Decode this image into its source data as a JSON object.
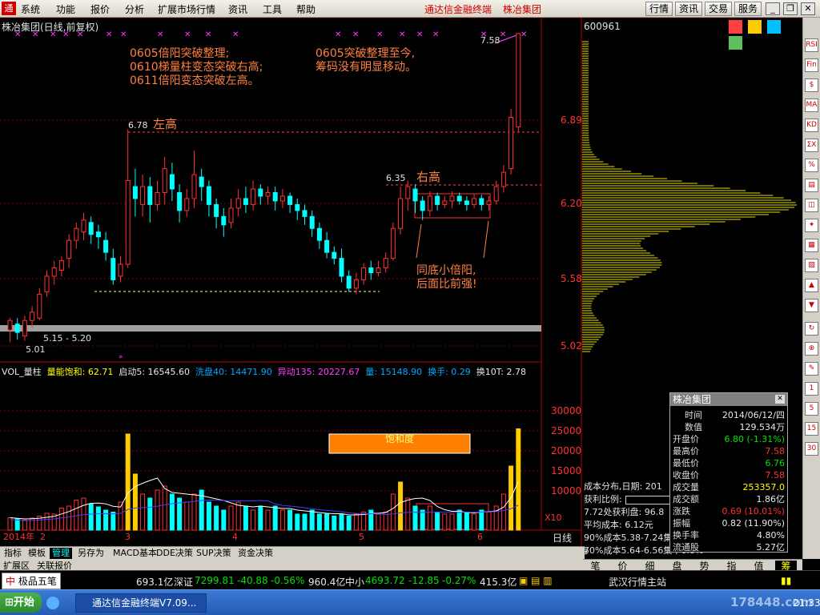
{
  "menu": {
    "items": [
      "系统",
      "功能",
      "报价",
      "分析",
      "扩展市场行情",
      "资讯",
      "工具",
      "帮助"
    ],
    "app_title": "通达信金融终端",
    "stock_title": "株冶集团",
    "buttons": [
      "行情",
      "资讯",
      "交易",
      "服务"
    ]
  },
  "chart": {
    "header": "株冶集团(日线,前复权)",
    "code": "600961",
    "price_labels": [
      "6.89",
      "6.20",
      "5.58",
      "5.02"
    ],
    "vol_labels": [
      "30000",
      "25000",
      "20000",
      "15000",
      "10000"
    ],
    "annotation1": [
      "0605倍阳突破整理;",
      "0610梯量柱变态突破右高;",
      "0611倍阳变态突破左高。"
    ],
    "annotation2": [
      "0605突破整理至今,",
      "筹码没有明显移动。"
    ],
    "left_high_label": "左高",
    "left_high_value": "6.78",
    "right_high_label": "右高",
    "right_high_value": "6.35",
    "peak_value": "7.58",
    "low_value": "5.01",
    "band_label": "5.15 - 5.20",
    "note": [
      "同底小倍阳,",
      "后面比前强!"
    ],
    "saturation_label": "饱和度",
    "x_labels": [
      "2014年",
      "2",
      "3",
      "4",
      "5",
      "6"
    ],
    "period": "日线",
    "x10": "X10",
    "vol_header": [
      {
        "t": "VOL_量柱",
        "c": "w"
      },
      {
        "t": "量能饱和: 62.71",
        "c": "y"
      },
      {
        "t": "启动5: 16545.60",
        "c": "w"
      },
      {
        "t": "洗盘40: 14471.90",
        "c": "c"
      },
      {
        "t": "异动135: 20227.67",
        "c": "m"
      },
      {
        "t": "量: 15148.90",
        "c": "c"
      },
      {
        "t": "换手: 0.29",
        "c": "c"
      },
      {
        "t": "换10T: 2.78",
        "c": "w"
      }
    ]
  },
  "cost": {
    "title": "成本分布,日期: 201",
    "ratio_label": "获利比例:",
    "row1": "7.72处获利盘: 96.8",
    "row2": "平均成本: 6.12元",
    "row3": "90%成本5.38-7.24集",
    "row4": "70%成本5.64-6.56集中6.8%"
  },
  "infobox": {
    "title": "株冶集团",
    "rows": [
      {
        "l": "时间",
        "v": "2014/06/12/四",
        "c": "w"
      },
      {
        "l": "数值",
        "v": "129.534万",
        "c": "w"
      },
      {
        "l": "开盘价",
        "v": "6.80 (-1.31%)",
        "c": "g"
      },
      {
        "l": "最高价",
        "v": "7.58",
        "c": "r"
      },
      {
        "l": "最低价",
        "v": "6.76",
        "c": "g"
      },
      {
        "l": "收盘价",
        "v": "7.58",
        "c": "r"
      },
      {
        "l": "成交量",
        "v": "253357.0",
        "c": "y"
      },
      {
        "l": "成交额",
        "v": "1.86亿",
        "c": "w"
      },
      {
        "l": "涨跌",
        "v": "0.69 (10.01%)",
        "c": "r"
      },
      {
        "l": "振幅",
        "v": "0.82 (11.90%)",
        "c": "w"
      },
      {
        "l": "换手率",
        "v": "4.80%",
        "c": "w"
      },
      {
        "l": "流通股",
        "v": "5.27亿",
        "c": "w"
      }
    ]
  },
  "bottom_tabs": [
    "指标",
    "模板",
    "管理",
    "另存为",
    "MACD基本",
    "DDE决策",
    "SUP决策",
    "资金决策"
  ],
  "ext_tabs": [
    "扩展区",
    "关联报价"
  ],
  "profile_tabs": [
    "笔",
    "价",
    "细",
    "盘",
    "势",
    "指",
    "值",
    "筹"
  ],
  "ticker": {
    "brand": "极品五笔",
    "t1": "693.1亿",
    "t2_name": "深证",
    "t2_val": "7299.81",
    "t2_chg": "-40.88",
    "t2_pct": "-0.56%",
    "t2_amt": "960.4亿",
    "t3_name": "中小",
    "t3_val": "4693.72",
    "t3_chg": "-12.85",
    "t3_pct": "-0.27%",
    "t3_amt": "415.3亿",
    "station": "武汉行情主站"
  },
  "taskbar": {
    "start": "开始",
    "window": "通达信金融终端V7.09...",
    "clock": "21:33",
    "watermark": "178448.com"
  },
  "right_tools": [
    "RSI",
    "Fin",
    "$",
    "MA",
    "KD",
    "ΣX",
    "%"
  ],
  "chart_data": {
    "type": "candlestick",
    "price_range": [
      4.9,
      7.62
    ],
    "volume_range": [
      0,
      32000
    ],
    "lines": {
      "left_high": 6.78,
      "right_high": 6.35,
      "support": 5.5,
      "band_low": 5.15
    },
    "candles": [
      [
        5.1,
        5.18,
        5.0,
        5.2
      ],
      [
        5.15,
        5.08,
        5.02,
        5.2
      ],
      [
        5.05,
        5.18,
        5.01,
        5.22
      ],
      [
        5.18,
        5.25,
        5.12,
        5.3
      ],
      [
        5.2,
        5.4,
        5.18,
        5.45
      ],
      [
        5.42,
        5.55,
        5.38,
        5.6
      ],
      [
        5.55,
        5.62,
        5.48,
        5.68
      ],
      [
        5.6,
        5.68,
        5.55,
        5.72
      ],
      [
        5.7,
        5.85,
        5.62,
        5.9
      ],
      [
        5.85,
        5.95,
        5.78,
        6.0
      ],
      [
        5.92,
        6.02,
        5.85,
        6.08
      ],
      [
        6.0,
        5.9,
        5.82,
        6.05
      ],
      [
        5.92,
        5.88,
        5.78,
        5.98
      ],
      [
        5.85,
        5.75,
        5.68,
        5.92
      ],
      [
        5.7,
        5.52,
        5.48,
        5.78
      ],
      [
        5.55,
        5.65,
        5.5,
        5.72
      ],
      [
        5.65,
        6.35,
        5.62,
        6.78
      ],
      [
        6.3,
        6.2,
        6.05,
        6.45
      ],
      [
        6.15,
        6.3,
        6.05,
        6.4
      ],
      [
        6.3,
        6.15,
        6.0,
        6.38
      ],
      [
        6.15,
        6.25,
        6.1,
        6.35
      ],
      [
        6.25,
        6.45,
        6.15,
        6.55
      ],
      [
        6.4,
        6.28,
        6.18,
        6.5
      ],
      [
        6.25,
        6.1,
        6.0,
        6.32
      ],
      [
        6.1,
        6.2,
        6.05,
        6.28
      ],
      [
        6.2,
        6.4,
        6.12,
        6.6
      ],
      [
        6.38,
        6.3,
        6.18,
        6.45
      ],
      [
        6.3,
        6.15,
        6.05,
        6.35
      ],
      [
        6.15,
        6.05,
        5.95,
        6.2
      ],
      [
        6.05,
        5.98,
        5.88,
        6.12
      ],
      [
        6.0,
        6.12,
        5.95,
        6.2
      ],
      [
        6.12,
        6.2,
        6.05,
        6.28
      ],
      [
        6.2,
        6.15,
        6.08,
        6.3
      ],
      [
        6.15,
        6.28,
        6.1,
        6.35
      ],
      [
        6.28,
        6.22,
        6.15,
        6.32
      ],
      [
        6.22,
        6.25,
        6.15,
        6.3
      ],
      [
        6.25,
        6.18,
        6.1,
        6.3
      ],
      [
        6.18,
        6.22,
        6.12,
        6.28
      ],
      [
        6.22,
        6.15,
        6.08,
        6.25
      ],
      [
        6.15,
        6.1,
        6.02,
        6.2
      ],
      [
        6.1,
        6.05,
        5.98,
        6.15
      ],
      [
        6.05,
        5.95,
        5.88,
        6.1
      ],
      [
        5.95,
        5.85,
        5.78,
        6.0
      ],
      [
        5.85,
        5.75,
        5.7,
        5.92
      ],
      [
        5.75,
        5.7,
        5.65,
        5.8
      ],
      [
        5.7,
        5.55,
        5.5,
        5.78
      ],
      [
        5.55,
        5.45,
        5.42,
        5.6
      ],
      [
        5.45,
        5.52,
        5.4,
        5.58
      ],
      [
        5.52,
        5.62,
        5.48,
        5.66
      ],
      [
        5.62,
        5.58,
        5.52,
        5.68
      ],
      [
        5.58,
        5.62,
        5.55,
        5.68
      ],
      [
        5.62,
        5.7,
        5.58,
        5.75
      ],
      [
        5.7,
        5.95,
        5.68,
        6.0
      ],
      [
        5.95,
        6.2,
        5.9,
        6.3
      ],
      [
        6.2,
        6.3,
        6.1,
        6.35
      ],
      [
        6.28,
        6.18,
        6.08,
        6.32
      ],
      [
        6.18,
        6.1,
        6.02,
        6.22
      ],
      [
        6.1,
        6.22,
        6.05,
        6.26
      ],
      [
        6.22,
        6.15,
        6.1,
        6.25
      ],
      [
        6.15,
        6.18,
        6.12,
        6.22
      ],
      [
        6.18,
        6.22,
        6.12,
        6.26
      ],
      [
        6.22,
        6.18,
        6.15,
        6.25
      ],
      [
        6.18,
        6.15,
        6.1,
        6.22
      ],
      [
        6.15,
        6.2,
        6.12,
        6.24
      ],
      [
        6.2,
        6.15,
        6.1,
        6.23
      ],
      [
        6.15,
        6.18,
        6.1,
        6.22
      ],
      [
        6.18,
        6.3,
        6.15,
        6.35
      ],
      [
        6.3,
        6.42,
        6.25,
        6.48
      ],
      [
        6.45,
        6.88,
        6.4,
        6.95
      ],
      [
        6.8,
        7.58,
        6.76,
        7.58
      ]
    ],
    "volumes": [
      3.1,
      2.8,
      2.5,
      3.0,
      3.5,
      4.2,
      4.0,
      5.5,
      6.0,
      7.5,
      8.0,
      6.5,
      5.8,
      5.0,
      4.5,
      7.0,
      24,
      14,
      9,
      8,
      10,
      11,
      9,
      8,
      7,
      9,
      10,
      7,
      6,
      5,
      6,
      7,
      6,
      5,
      6,
      5,
      6,
      5,
      5,
      4,
      4,
      5,
      4,
      4,
      3.5,
      4,
      3.5,
      4,
      4.5,
      5,
      4,
      4.5,
      9,
      12,
      8,
      6,
      5,
      6,
      4.5,
      4,
      4,
      5,
      4.5,
      4,
      5,
      4.5,
      6,
      9,
      16,
      25.3
    ]
  }
}
